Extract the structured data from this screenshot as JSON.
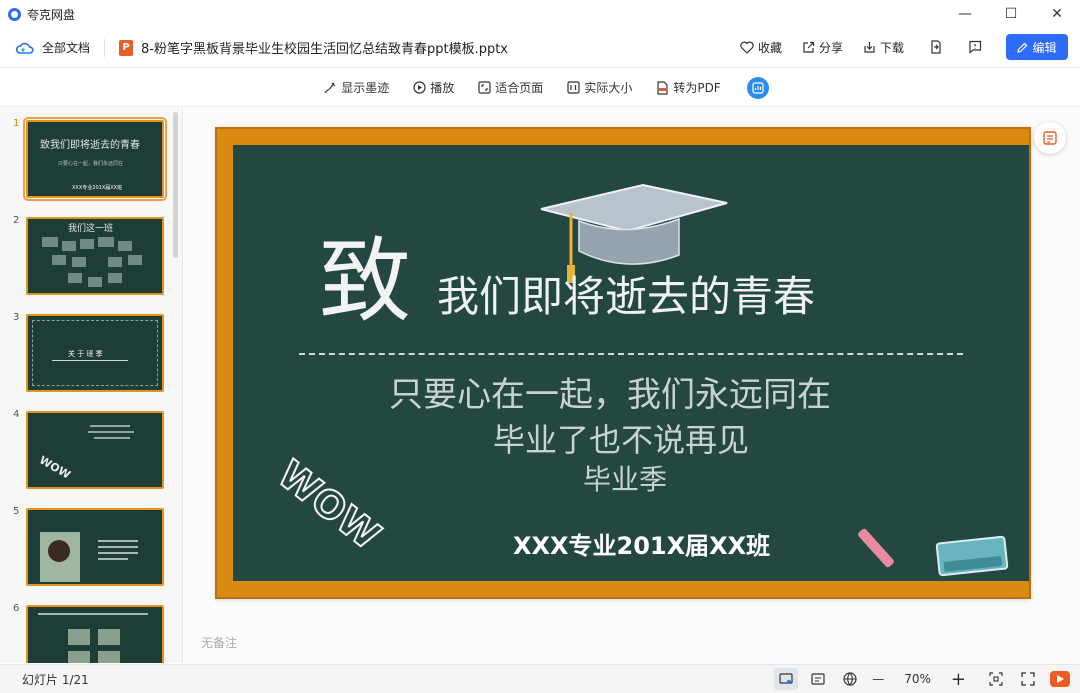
{
  "window": {
    "app_name": "夸克网盘",
    "controls": {
      "minimize": "—",
      "maximize": "☐",
      "close": "✕"
    }
  },
  "toolbar": {
    "all_docs_label": "全部文档",
    "file_icon_letter": "P",
    "file_name": "8-粉笔字黑板背景毕业生校园生活回忆总结致青春ppt模板.pptx",
    "collect_label": "收藏",
    "share_label": "分享",
    "download_label": "下载",
    "edit_label": "编辑"
  },
  "subbar": {
    "show_ink_label": "显示墨迹",
    "play_label": "播放",
    "fit_page_label": "适合页面",
    "actual_size_label": "实际大小",
    "to_pdf_label": "转为PDF"
  },
  "thumbnails": [
    {
      "number": "1",
      "title": "致我们即将逝去的青春",
      "active": true
    },
    {
      "number": "2",
      "title": "我们这一班",
      "active": false
    },
    {
      "number": "3",
      "title": "关 于 班 季",
      "active": false
    },
    {
      "number": "4",
      "title": "",
      "active": false
    },
    {
      "number": "5",
      "title": "",
      "active": false
    },
    {
      "number": "6",
      "title": "",
      "active": false
    }
  ],
  "slide": {
    "big_char": "致",
    "title_rest": "我们即将逝去的青春",
    "line1": "只要心在一起，我们永远同在",
    "line2": "毕业了也不说再见",
    "line3": "毕业季",
    "class_line": "XXX专业201X届XX班",
    "wow_text": "WOW"
  },
  "notes_placeholder": "无备注",
  "status": {
    "slide_count": "幻灯片 1/21",
    "zoom_minus": "—",
    "zoom_level": "70%",
    "zoom_plus": "+"
  },
  "colors": {
    "accent": "#2d6cf6",
    "board": "#244741",
    "frame": "#d98a12",
    "ppt_icon": "#e85d28"
  }
}
